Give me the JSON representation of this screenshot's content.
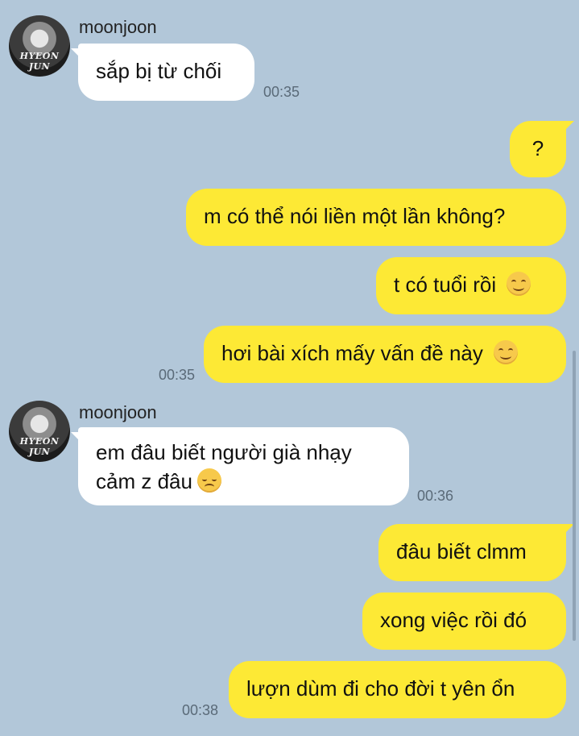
{
  "colors": {
    "background": "#b2c7d9",
    "incoming": "#ffffff",
    "outgoing": "#fde935"
  },
  "messages": [
    {
      "id": "m1",
      "direction": "in",
      "sender": "moonjoon",
      "avatar_text": "HYEON JUN",
      "text": "sắp bị từ chối",
      "time": "00:35"
    },
    {
      "id": "m2",
      "direction": "out",
      "text": "?"
    },
    {
      "id": "m3",
      "direction": "out",
      "text": "m có thể nói liền một lần không?"
    },
    {
      "id": "m4",
      "direction": "out",
      "text": "t có tuổi rồi",
      "emoji": "smiling-face-icon"
    },
    {
      "id": "m5",
      "direction": "out",
      "text": "hơi bài xích mấy vấn đề này",
      "emoji": "smiling-face-icon",
      "time": "00:35"
    },
    {
      "id": "m6",
      "direction": "in",
      "sender": "moonjoon",
      "avatar_text": "HYEON JUN",
      "line1": "em đâu biết người già nhạy",
      "line2": "cảm z đâu",
      "emoji": "disappointed-face-icon",
      "time": "00:36"
    },
    {
      "id": "m7",
      "direction": "out",
      "text": "đâu biết clmm"
    },
    {
      "id": "m8",
      "direction": "out",
      "text": "xong việc rồi đó"
    },
    {
      "id": "m9",
      "direction": "out",
      "text": "lượn dùm đi cho đời t yên ổn",
      "time": "00:38"
    }
  ]
}
